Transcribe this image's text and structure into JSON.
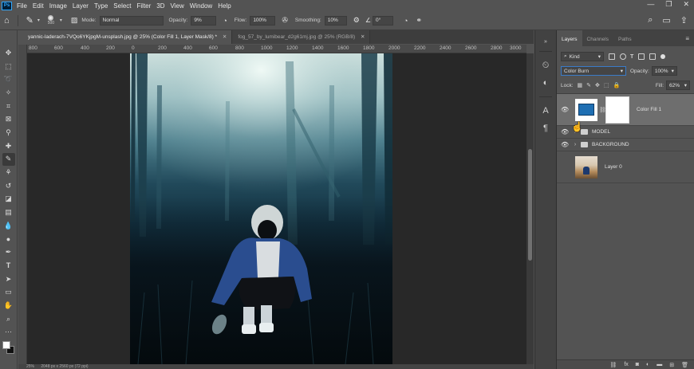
{
  "app": {
    "logo": "Ps"
  },
  "menu": [
    "File",
    "Edit",
    "Image",
    "Layer",
    "Type",
    "Select",
    "Filter",
    "3D",
    "View",
    "Window",
    "Help"
  ],
  "window_controls": [
    "—",
    "❐",
    "✕"
  ],
  "options": {
    "brush_size": "500",
    "mode_label": "Mode:",
    "mode_value": "Normal",
    "opacity_label": "Opacity:",
    "opacity_value": "9%",
    "flow_label": "Flow:",
    "flow_value": "100%",
    "smoothing_label": "Smoothing:",
    "smoothing_value": "10%",
    "angle_value": "0°"
  },
  "tabs": [
    {
      "label": "yannic-laderach-7VQo6YKjpgM-unsplash.jpg @ 25% (Color Fill 1, Layer Mask/8) *",
      "active": true
    },
    {
      "label": "fog_57_by_lumibear_d2g61mj.jpg @ 25% (RGB/8)",
      "active": false
    }
  ],
  "ruler_ticks": [
    "800",
    "600",
    "400",
    "200",
    "0",
    "200",
    "400",
    "600",
    "800",
    "1000",
    "1200",
    "1400",
    "1600",
    "1800",
    "2000",
    "2200",
    "2400",
    "2600",
    "2800",
    "3000"
  ],
  "status": {
    "zoom": "25%",
    "doc": "2048 px x 2560 px (72 ppi)"
  },
  "layers_panel": {
    "tabs": [
      "Layers",
      "Channels",
      "Paths"
    ],
    "kind_label": "Kind",
    "blend_mode": "Color Burn",
    "opacity_label": "Opacity:",
    "opacity_value": "100%",
    "lock_label": "Lock:",
    "fill_label": "Fill:",
    "fill_value": "62%",
    "layers": [
      {
        "name": "Color Fill 1",
        "type": "fill",
        "visible": true,
        "selected": true
      },
      {
        "name": "MODEL",
        "type": "group",
        "visible": true
      },
      {
        "name": "BACKGROUND",
        "type": "group",
        "visible": true
      },
      {
        "name": "Layer 0",
        "type": "pixel",
        "visible": false
      }
    ],
    "bottom_icons": [
      "link-icon",
      "fx-icon",
      "mask-icon",
      "adjustment-icon",
      "folder-icon",
      "new-layer-icon",
      "trash-icon"
    ]
  },
  "colors": {
    "foreground": "#ffffff",
    "background": "#111111",
    "fill_swatch": "#1f6fb3"
  }
}
